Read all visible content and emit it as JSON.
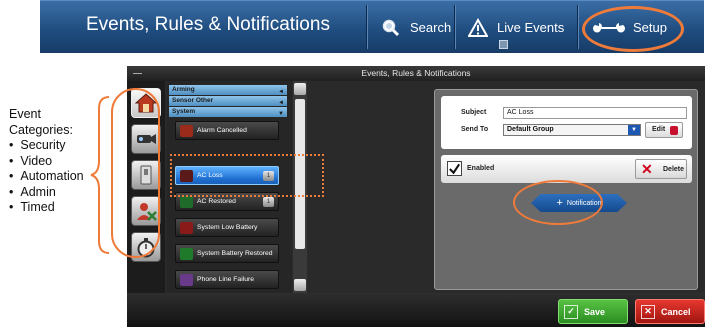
{
  "topbar": {
    "title": "Events, Rules & Notifications",
    "search_label": "Search",
    "live_events_label": "Live Events",
    "setup_label": "Setup"
  },
  "annotation": {
    "heading_line1": "Event",
    "heading_line2": "Categories:",
    "items": [
      "Security",
      "Video",
      "Automation",
      "Admin",
      "Timed"
    ]
  },
  "window": {
    "title": "Events, Rules & Notifications"
  },
  "categories": [
    {
      "icon": "house-shield-icon",
      "active": true
    },
    {
      "icon": "camera-icon",
      "active": false
    },
    {
      "icon": "light-switch-icon",
      "active": false
    },
    {
      "icon": "admin-user-icon",
      "active": false
    },
    {
      "icon": "stopwatch-icon",
      "active": false
    }
  ],
  "groups": [
    {
      "label": "Arming",
      "toggle": "◄"
    },
    {
      "label": "Sensor Other",
      "toggle": "◄"
    },
    {
      "label": "System",
      "toggle": "▼"
    }
  ],
  "rules": [
    {
      "label": "Alarm Cancelled",
      "icon": "alarm-cancelled-icon",
      "badge": "",
      "selected": false
    },
    {
      "label": "AC Loss",
      "icon": "ac-loss-icon",
      "badge": "1",
      "selected": true
    },
    {
      "label": "AC Restored",
      "icon": "ac-restored-icon",
      "badge": "1",
      "selected": false
    },
    {
      "label": "System Low Battery",
      "icon": "low-battery-icon",
      "badge": "",
      "selected": false
    },
    {
      "label": "System Battery Restored",
      "icon": "battery-restored-icon",
      "badge": "",
      "selected": false
    },
    {
      "label": "Phone Line Failure",
      "icon": "phone-line-failure-icon",
      "badge": "",
      "selected": false
    }
  ],
  "detail": {
    "subject_label": "Subject",
    "subject_value": "AC Loss",
    "send_to_label": "Send To",
    "send_to_value": "Default Group",
    "edit_label": "Edit",
    "enabled_label": "Enabled",
    "enabled_checked": true,
    "delete_label": "Delete",
    "notification_label": "Notification"
  },
  "footer": {
    "save_label": "Save",
    "cancel_label": "Cancel"
  },
  "colors": {
    "highlight_orange": "#ef7b3a",
    "selected_blue": "#1f6fd0",
    "save_green": "#2c8e22",
    "cancel_red": "#a01510"
  }
}
